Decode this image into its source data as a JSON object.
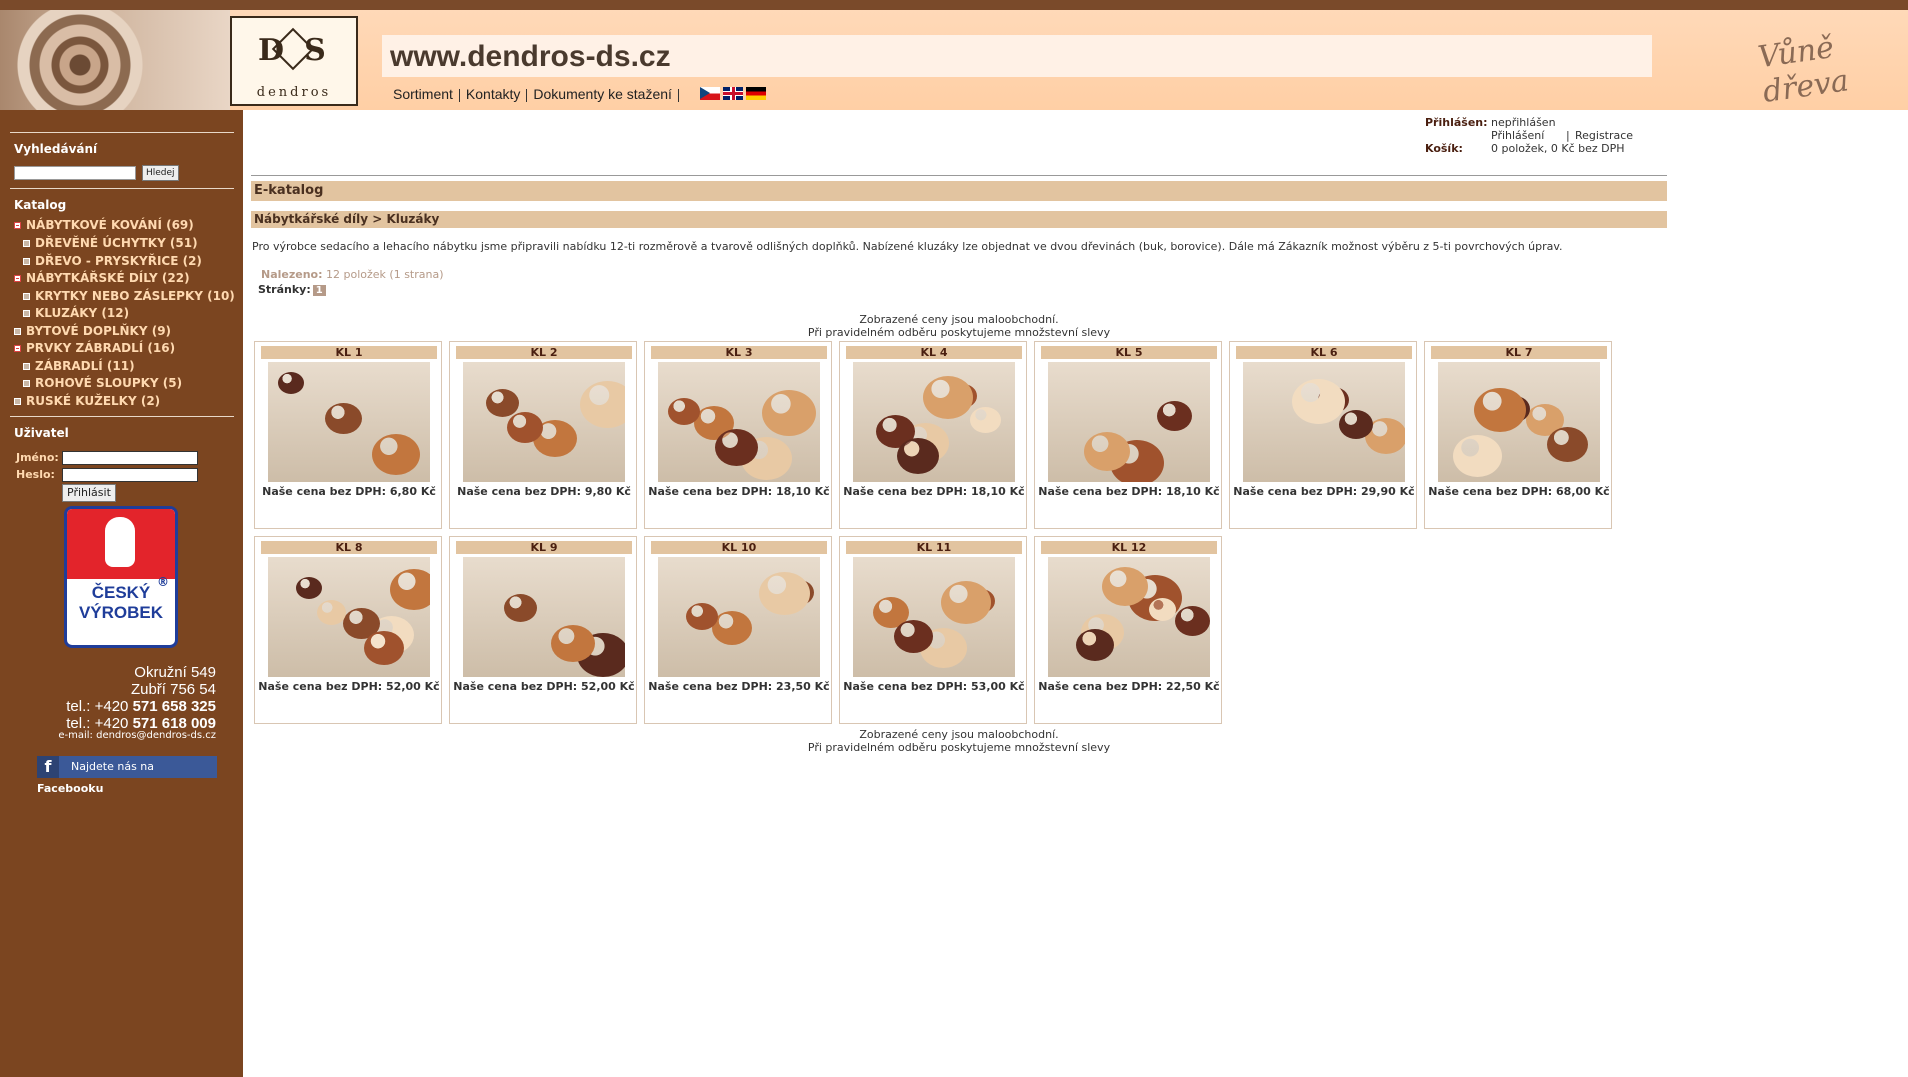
{
  "site": {
    "url": "www.dendros-ds.cz",
    "logo_letters": "D S",
    "logo_name": "dendros",
    "slogan": "Vůně dřeva"
  },
  "topnav": {
    "items": [
      "Sortiment",
      "Kontakty",
      "Dokumenty ke stažení"
    ],
    "flags": [
      "cz-flag-icon",
      "uk-flag-icon",
      "de-flag-icon"
    ]
  },
  "sidebar": {
    "search_title": "Vyhledávání",
    "search_button": "Hledej",
    "catalog_title": "Katalog",
    "categories": [
      {
        "label": "NÁBYTKOVÉ KOVÁNÍ (69)",
        "level": 0,
        "expanded": true
      },
      {
        "label": "DŘEVĚNÉ ÚCHYTKY (51)",
        "level": 1,
        "expanded": false
      },
      {
        "label": "DŘEVO - PRYSKYŘICE (2)",
        "level": 1,
        "expanded": false
      },
      {
        "label": "NÁBYTKÁŘSKÉ DÍLY (22)",
        "level": 0,
        "expanded": true
      },
      {
        "label": "KRYTKY NEBO ZÁSLEPKY (10)",
        "level": 1,
        "expanded": false
      },
      {
        "label": "KLUZÁKY (12)",
        "level": 1,
        "expanded": false
      },
      {
        "label": "BYTOVÉ DOPLŇKY (9)",
        "level": 0,
        "expanded": false
      },
      {
        "label": "PRVKY ZÁBRADLÍ (16)",
        "level": 0,
        "expanded": true
      },
      {
        "label": "ZÁBRADLÍ (11)",
        "level": 1,
        "expanded": false
      },
      {
        "label": "ROHOVÉ SLOUPKY (5)",
        "level": 1,
        "expanded": false
      },
      {
        "label": "RUSKÉ KUŽELKY (2)",
        "level": 0,
        "expanded": false
      }
    ],
    "user_title": "Uživatel",
    "name_label": "Jméno:",
    "password_label": "Heslo:",
    "login_button": "Přihlásit",
    "badge_text_1": "ČESKÝ",
    "badge_text_2": "VÝROBEK",
    "badge_reg": "®",
    "address": {
      "line1": "Okružní 549",
      "line2": "Zubří 756 54",
      "tel1_prefix": "tel.: +420 ",
      "tel1_number": "571 658 325",
      "tel2_prefix": "tel.: +420 ",
      "tel2_number": "571 618 009",
      "email": "e-mail: dendros@dendros-ds.cz"
    },
    "facebook": {
      "icon_letter": "f",
      "prefix": "Najdete nás na ",
      "name": "Facebooku"
    }
  },
  "user_box": {
    "logged_label": "Přihlášen:",
    "logged_value": "nepřihlášen",
    "login_link": "Přihlášení",
    "register_link": "Registrace",
    "cart_label": "Košík:",
    "cart_value": "0 položek, 0 Kč bez DPH"
  },
  "main": {
    "section_title": "E-katalog",
    "breadcrumb": "Nábytkářské díly > Kluzáky",
    "intro": "Pro výrobce sedacího a lehacího nábytku jsme připravili nabídku 12-ti rozměrově a tvarově odlišných doplňků. Nabízené kluzáky lze objednat ve dvou dřevinách (buk, borovice). Dále má Zákazník možnost výběru z 5-ti povrchových úprav.",
    "found_label": "Nalezeno:",
    "found_value": "12 položek (1 strana)",
    "pages_label": "Stránky:",
    "page_current": "1",
    "note_line1": "Zobrazené ceny jsou maloobchodní.",
    "note_line2": "Při pravidelném odběru poskytujeme množstevní slevy"
  },
  "products": [
    {
      "title": "KL 1",
      "price": "Naše cena bez DPH: 6,80 Kč"
    },
    {
      "title": "KL 2",
      "price": "Naše cena bez DPH: 9,80 Kč"
    },
    {
      "title": "KL 3",
      "price": "Naše cena bez DPH: 18,10 Kč"
    },
    {
      "title": "KL 4",
      "price": "Naše cena bez DPH: 18,10 Kč"
    },
    {
      "title": "KL 5",
      "price": "Naše cena bez DPH: 18,10 Kč"
    },
    {
      "title": "KL 6",
      "price": "Naše cena bez DPH: 29,90 Kč"
    },
    {
      "title": "KL 7",
      "price": "Naše cena bez DPH: 68,00 Kč"
    },
    {
      "title": "KL 8",
      "price": "Naše cena bez DPH: 52,00 Kč"
    },
    {
      "title": "KL 9",
      "price": "Naše cena bez DPH: 52,00 Kč"
    },
    {
      "title": "KL 10",
      "price": "Naše cena bez DPH: 23,50 Kč"
    },
    {
      "title": "KL 11",
      "price": "Naše cena bez DPH: 53,00 Kč"
    },
    {
      "title": "KL 12",
      "price": "Naše cena bez DPH: 22,50 Kč"
    }
  ],
  "colors": {
    "sidebar_bg": "#7b4520",
    "header_bg": "#ffd9b8",
    "bar_bg": "#e2c4a0",
    "title_text": "#4a1f10"
  }
}
